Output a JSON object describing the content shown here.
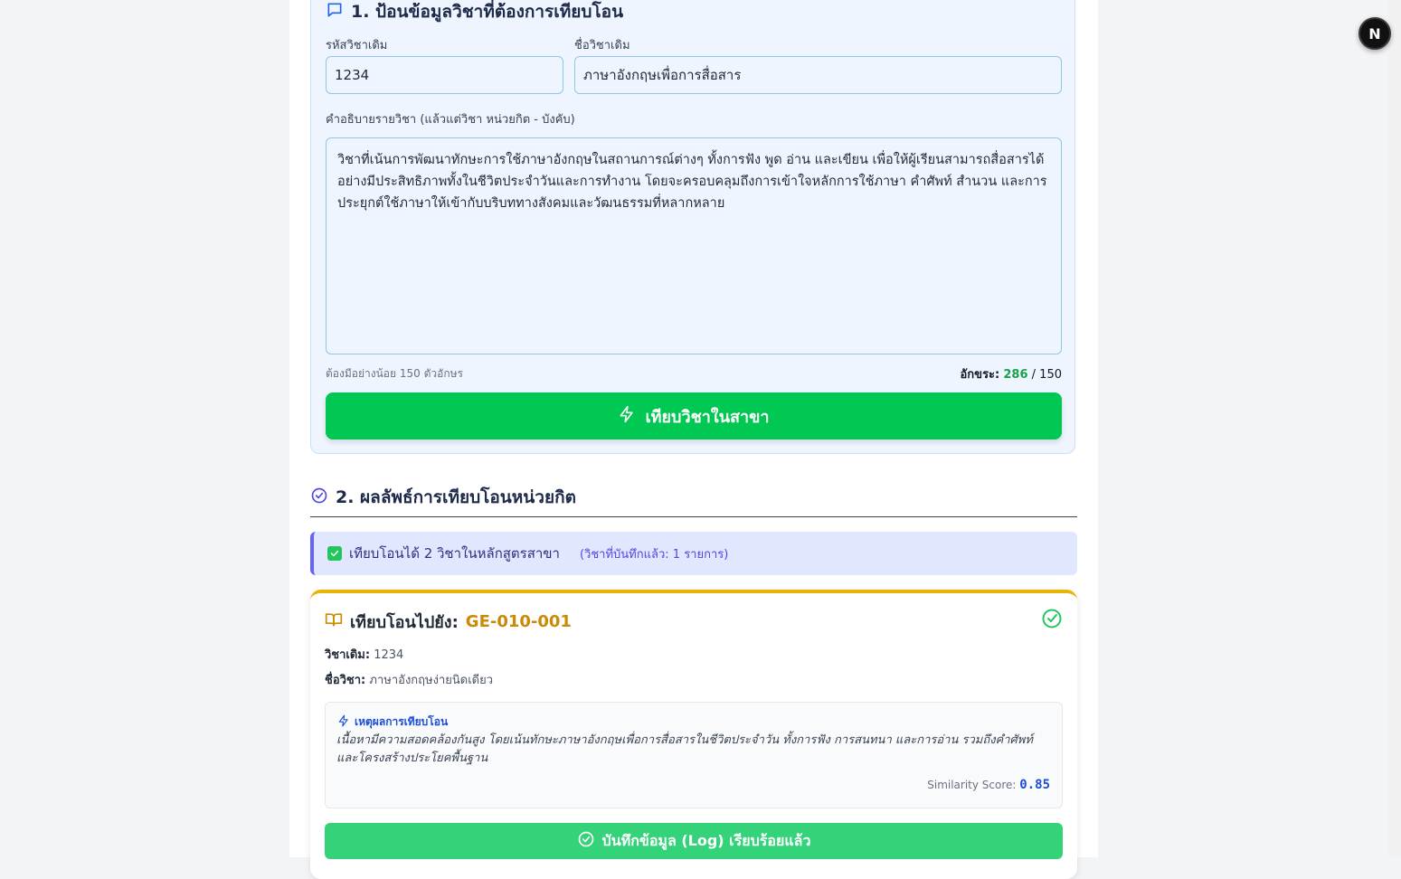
{
  "section1": {
    "title": "1. ป้อนข้อมูลวิชาที่ต้องการเทียบโอน",
    "code_label": "รหัสวิชาเดิม",
    "code_value": "1234",
    "name_label": "ชื่อวิชาเดิม",
    "name_value": "ภาษาอังกฤษเพื่อการสื่อสาร",
    "desc_label": "คำอธิบายรายวิชา (แล้วแต่วิชา หน่วยกิต - บังคับ)",
    "desc_value": "วิชาที่เน้นการพัฒนาทักษะการใช้ภาษาอังกฤษในสถานการณ์ต่างๆ ทั้งการฟัง พูด อ่าน และเขียน เพื่อให้ผู้เรียนสามารถสื่อสารได้อย่างมีประสิทธิภาพทั้งในชีวิตประจำวันและการทำงาน โดยจะครอบคลุมถึงการเข้าใจหลักการใช้ภาษา คำศัพท์ สำนวน และการประยุกต์ใช้ภาษาให้เข้ากับบริบททางสังคมและวัฒนธรรมที่หลากหลาย",
    "hint": "ต้องมีอย่างน้อย 150 ตัวอักษร",
    "counter_label": "อักขระ:",
    "counter_value": "286",
    "counter_sep": " / ",
    "counter_min": "150",
    "compare_button": "เทียบวิชาในสาขา"
  },
  "section2": {
    "title": "2. ผลลัพธ์การเทียบโอนหน่วยกิต",
    "summary": "เทียบโอนได้ 2 วิชาในหลักสูตรสาขา",
    "summary_saved": "(วิชาที่บันทึกแล้ว: 1 รายการ)",
    "result": {
      "heading_prefix": "เทียบโอนไปยัง:",
      "target_code": "GE-010-001",
      "orig_label": "วิชาเดิม:",
      "orig_value": "1234",
      "name_label": "ชื่อวิชา:",
      "name_value": "ภาษาอังกฤษง่ายนิดเดียว",
      "reason_title": "เหตุผลการเทียบโอน",
      "reason_text": "เนื้อหามีความสอดคล้องกันสูง โดยเน้นทักษะภาษาอังกฤษเพื่อการสื่อสารในชีวิตประจำวัน ทั้งการฟัง การสนทนา และการอ่าน รวมถึงคำศัพท์และโครงสร้างประโยคพื้นฐาน",
      "score_label": "Similarity Score:",
      "score_value": "0.85",
      "log_button": "บันทึกข้อมูล (Log) เรียบร้อยแล้ว"
    }
  },
  "badge": "N",
  "colors": {
    "accent_green": "#00c853",
    "accent_blue": "#1d4ed8",
    "accent_gold": "#ca8a04",
    "accent_indigo": "#6366f1"
  },
  "icons": [
    "chat-icon",
    "check-circle-icon",
    "check-square-icon",
    "book-icon",
    "bolt-icon"
  ]
}
